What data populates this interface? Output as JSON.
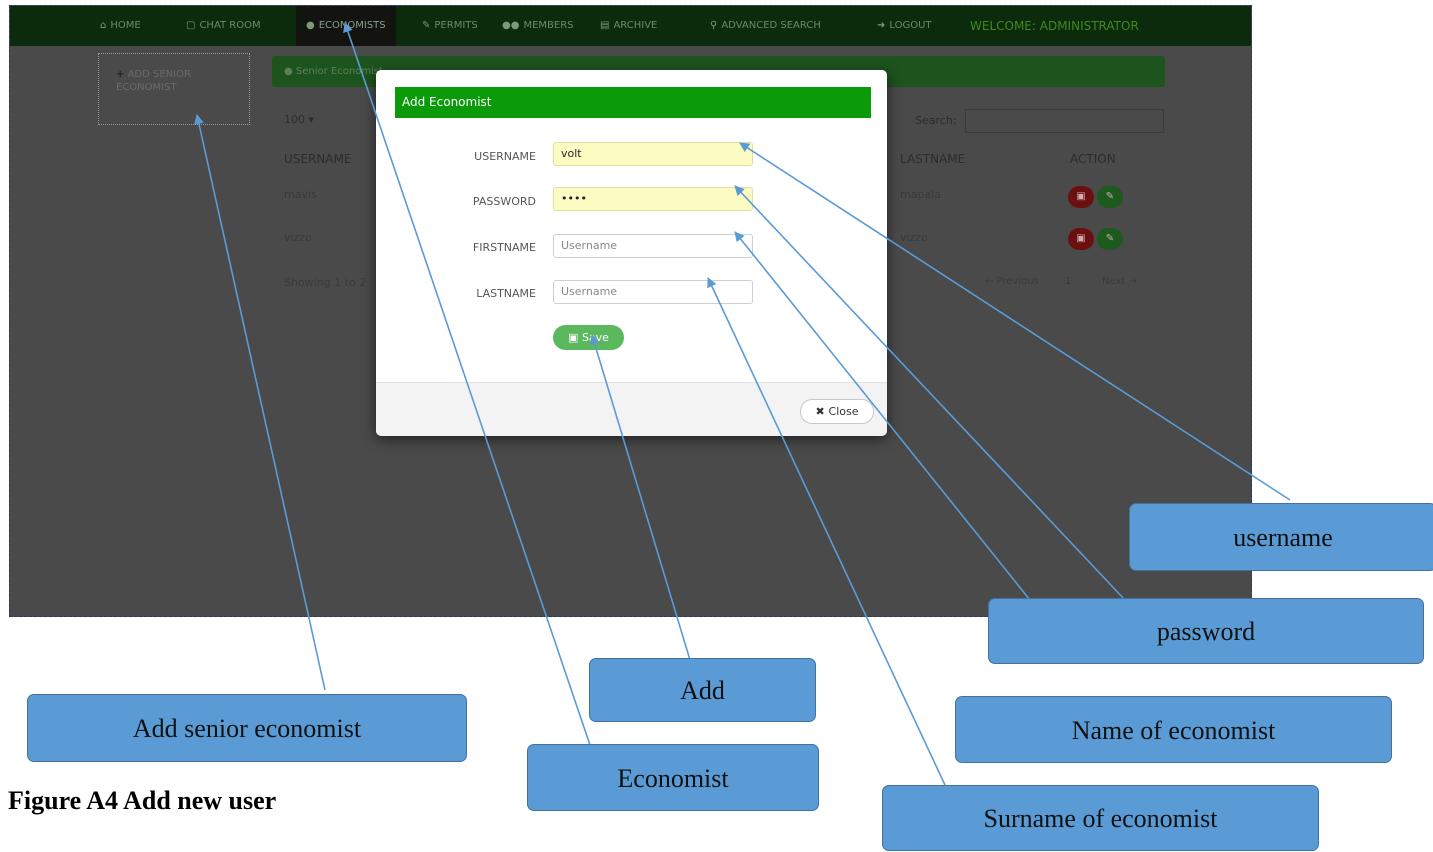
{
  "navbar": {
    "items": [
      {
        "icon": "home-icon",
        "label": "HOME"
      },
      {
        "icon": "document-icon",
        "label": "CHAT ROOM"
      },
      {
        "icon": "user-icon",
        "label": "ECONOMISTS"
      },
      {
        "icon": "edit-icon",
        "label": "PERMITS"
      },
      {
        "icon": "users-icon",
        "label": "MEMBERS"
      },
      {
        "icon": "archive-icon",
        "label": "ARCHIVE"
      },
      {
        "icon": "search-icon",
        "label": "ADVANCED SEARCH"
      },
      {
        "icon": "logout-icon",
        "label": "LOGOUT"
      }
    ],
    "welcome": "WELCOME: ADMINISTRATOR"
  },
  "sidebar": {
    "add_label": "ADD SENIOR ECONOMIST"
  },
  "background": {
    "panel_title": "Senior Economist",
    "length_value": "100",
    "search_label": "Search:",
    "columns": [
      "USERNAME",
      "LASTNAME",
      "ACTION"
    ],
    "rows": [
      {
        "username": "mavis",
        "lastname": "mapala"
      },
      {
        "username": "vizzo",
        "lastname": "vizzo"
      }
    ],
    "showing": "Showing 1 to 2",
    "pagination": {
      "previous": "← Previous",
      "page": "1",
      "next": "Next →"
    }
  },
  "modal": {
    "title": "Add Economist",
    "fields": [
      {
        "label": "USERNAME",
        "value": "volt",
        "placeholder": ""
      },
      {
        "label": "PASSWORD",
        "value": "••••",
        "placeholder": ""
      },
      {
        "label": "FIRSTNAME",
        "value": "",
        "placeholder": "Username"
      },
      {
        "label": "LASTNAME",
        "value": "",
        "placeholder": "Username"
      }
    ],
    "save_label": "Save",
    "close_label": "Close"
  },
  "callouts": {
    "username": "username",
    "password": "password",
    "add": "Add",
    "add_senior": "Add senior economist",
    "name": "Name of economist",
    "economist": "Economist",
    "surname": "Surname of economist"
  },
  "caption": "Figure A4 Add new user",
  "colors": {
    "callout_fill": "#5b9bd5",
    "arrow": "#5b9bd5",
    "navbar": "#0c2a0c",
    "modal_header": "#0a9a0a"
  }
}
